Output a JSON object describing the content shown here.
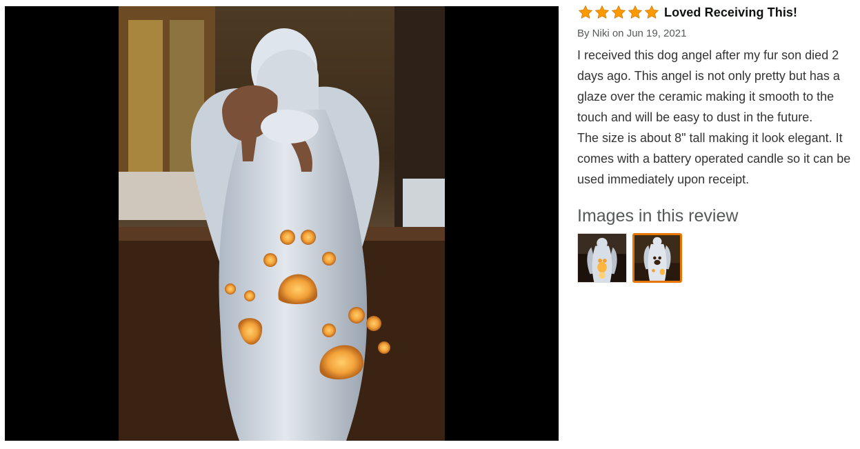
{
  "review": {
    "rating": 5,
    "rating_max": 5,
    "title": "Loved Receiving This!",
    "byline": "By Niki on Jun 19, 2021",
    "paragraphs": [
      "I received this dog angel after my fur son died 2 days ago. This angel is not only pretty but has a glaze over the ceramic making it smooth to the touch and will be easy to dust in the future.",
      "The size is about 8\" tall making it look elegant. It comes with a battery operated candle so it can be used immediately upon receipt."
    ]
  },
  "images_section": {
    "heading": "Images in this review",
    "selected_index": 1,
    "thumbnail_count": 2
  },
  "colors": {
    "star": "#ff9900",
    "selected_border": "#e77600",
    "viewer_bg": "#000000"
  },
  "icons": {
    "rating": "star-icon"
  }
}
